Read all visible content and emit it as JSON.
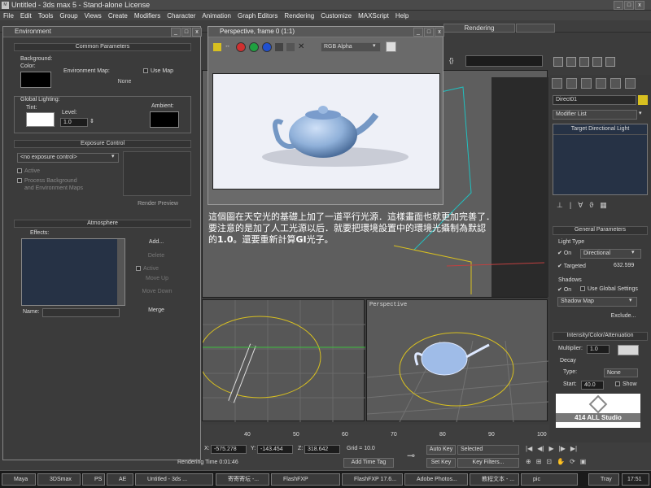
{
  "app": {
    "title": "Untitled - 3ds max 5 - Stand-alone License"
  },
  "menu": [
    "File",
    "Edit",
    "Tools",
    "Group",
    "Views",
    "Create",
    "Modifiers",
    "Character",
    "Animation",
    "Graph Editors",
    "Rendering",
    "Customize",
    "MAXScript",
    "Help"
  ],
  "toolbar": {
    "rendering_tab": "Rendering"
  },
  "environment": {
    "title": "Environment",
    "common_header": "Common Parameters",
    "background_label": "Background:",
    "color_label": "Color:",
    "env_map_label": "Environment Map:",
    "use_map_label": "Use Map",
    "env_map_value": "None",
    "global_lighting_label": "Global Lighting:",
    "tint_label": "Tint:",
    "level_label": "Level:",
    "level_value": "1.0",
    "ambient_label": "Ambient:",
    "exposure_header": "Exposure Control",
    "exposure_select": "<no exposure control>",
    "active_label": "Active",
    "process_bg_label": "Process Background",
    "and_env_label": "and Environment Maps",
    "render_preview": "Render Preview",
    "atmosphere_header": "Atmosphere",
    "effects_label": "Effects:",
    "add_btn": "Add...",
    "delete_btn": "Delete",
    "active_chk": "Active",
    "move_up": "Move Up",
    "move_down": "Move Down",
    "name_label": "Name:",
    "merge_btn": "Merge"
  },
  "render_window": {
    "title": "Perspective, frame 0 (1:1)",
    "channel_select": "RGB Alpha"
  },
  "caption": {
    "line1": "這個圖在天空光的基礎上加了一道平行光源．這樣畫面也就更加完善了．",
    "line2": "要注意的是加了人工光源以后．就要把環境設置中的環境光攝制為默認",
    "line3_prefix": "的",
    "line3_bold1": "1.0",
    "line3_mid": "。還要重新計算",
    "line3_bold2": "GI",
    "line3_suffix": "光子。"
  },
  "viewports": {
    "perspective_label": "Perspective"
  },
  "command_panel": {
    "object_name": "Direct01",
    "modifier_list": "Modifier List",
    "stack_item": "Target Directional Light",
    "general_header": "General Parameters",
    "light_type_label": "Light Type",
    "on_label": "On",
    "type_value": "Directional",
    "targeted_label": "Targeted",
    "targeted_value": "632.599",
    "shadows_label": "Shadows",
    "shadows_on": "On",
    "use_global": "Use Global Settings",
    "shadow_type": "Shadow Map",
    "exclude_btn": "Exclude...",
    "intensity_header": "Intensity/Color/Attenuation",
    "multiplier_label": "Multiplier:",
    "multiplier_value": "1.0",
    "decay_label": "Decay",
    "decay_type_label": "Type:",
    "decay_type_value": "None",
    "start_label": "Start:",
    "start_value": "40.0",
    "show_label": "Show",
    "logo_text": "414 ALL Studio"
  },
  "timeline": {
    "ticks": [
      "40",
      "50",
      "60",
      "70",
      "80",
      "90",
      "100"
    ],
    "x_label": "X:",
    "x_value": "-575.278",
    "y_label": "Y:",
    "y_value": "-143.454",
    "z_label": "Z:",
    "z_value": "318.642",
    "grid": "Grid = 10.0",
    "rendering_time": "Rendering Time  0:01:46",
    "add_time_tag": "Add Time Tag",
    "auto_key": "Auto Key",
    "set_key": "Set Key",
    "selected": "Selected",
    "key_filters": "Key Filters..."
  },
  "taskbar": {
    "items": [
      "Maya",
      "3DSmax",
      "PS",
      "AE",
      "Untitled - 3ds ...",
      "寄寄寄坛 -...",
      "FlashFXP",
      "FlashFXP 17.6...",
      "Adobe Photos...",
      "教程文本 - ...",
      "pic"
    ],
    "tray": "Tray",
    "clock": "17:51"
  },
  "colors": {
    "render_bg": "#eef0f7",
    "teapot": "#8fb0d9",
    "accent_yellow": "#d8c020"
  }
}
